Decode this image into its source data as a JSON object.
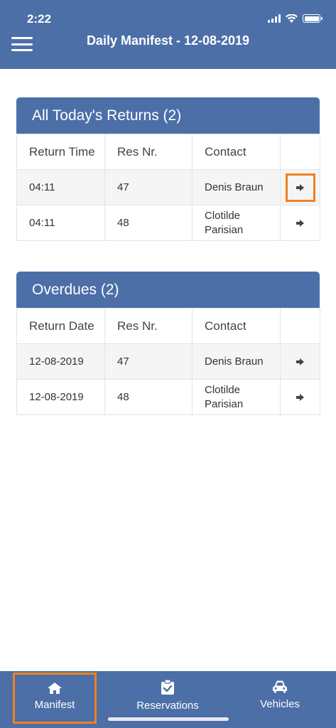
{
  "status_bar": {
    "time": "2:22"
  },
  "header": {
    "title": "Daily Manifest - 12-08-2019",
    "menu_icon": "hamburger-menu-icon"
  },
  "returns_panel": {
    "title": "All Today's Returns (2)",
    "columns": [
      "Return Time",
      "Res Nr.",
      "Contact",
      ""
    ],
    "rows": [
      {
        "time": "04:11",
        "res_nr": "47",
        "contact": "Denis Braun"
      },
      {
        "time": "04:11",
        "res_nr": "48",
        "contact_line1": "Clotilde",
        "contact_line2": "Parisian"
      }
    ]
  },
  "overdues_panel": {
    "title": "Overdues (2)",
    "columns": [
      "Return Date",
      "Res Nr.",
      "Contact",
      ""
    ],
    "rows": [
      {
        "date": "12-08-2019",
        "res_nr": "47",
        "contact": "Denis Braun"
      },
      {
        "date": "12-08-2019",
        "res_nr": "48",
        "contact_line1": "Clotilde",
        "contact_line2": "Parisian"
      }
    ]
  },
  "tabbar": {
    "tabs": [
      {
        "label": "Manifest",
        "icon": "home-icon"
      },
      {
        "label": "Reservations",
        "icon": "clipboard-check-icon"
      },
      {
        "label": "Vehicles",
        "icon": "car-icon"
      }
    ]
  },
  "colors": {
    "primary": "#4c6fa8",
    "highlight": "#f08020",
    "row_alt": "#f5f5f5",
    "border": "#e4e4e4"
  }
}
